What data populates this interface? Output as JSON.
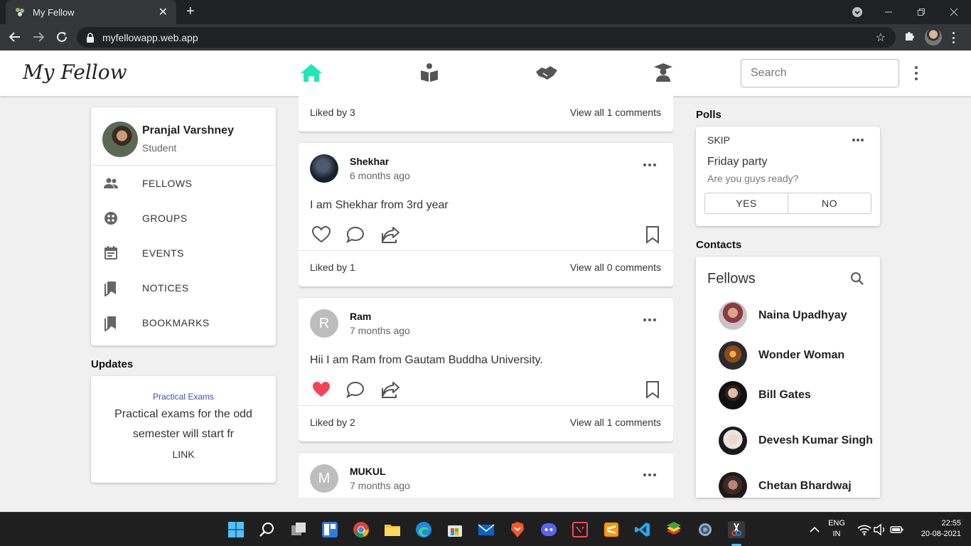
{
  "browser": {
    "tab_title": "My Fellow",
    "tab_close": "✕",
    "new_tab": "+",
    "url": "myfellowapp.web.app"
  },
  "app": {
    "logo": "My Fellow",
    "search_placeholder": "Search",
    "accent_color": "#1de9b6"
  },
  "profile": {
    "name": "Pranjal Varshney",
    "role": "Student"
  },
  "menu": [
    {
      "label": "FELLOWS",
      "icon": "people-icon"
    },
    {
      "label": "GROUPS",
      "icon": "groups-icon"
    },
    {
      "label": "EVENTS",
      "icon": "events-icon"
    },
    {
      "label": "NOTICES",
      "icon": "notices-icon"
    },
    {
      "label": "BOOKMARKS",
      "icon": "bookmarks-icon"
    }
  ],
  "updates": {
    "title": "Updates",
    "category": "Practical Exams",
    "text": "Practical exams for the odd semester will start fr",
    "link": "LINK"
  },
  "posts": [
    {
      "likes": "Liked by 3",
      "comments": "View all 1 comments"
    },
    {
      "name": "Shekhar",
      "time": "6 months ago",
      "text": "I am Shekhar from 3rd year",
      "liked": false,
      "likes": "Liked by 1",
      "comments": "View all 0 comments"
    },
    {
      "name": "Ram",
      "initial": "R",
      "time": "7 months ago",
      "text": "Hii I am Ram from Gautam Buddha University.",
      "liked": true,
      "likes": "Liked by 2",
      "comments": "View all 1 comments"
    },
    {
      "name": "MUKUL",
      "initial": "M",
      "time": "7 months ago"
    }
  ],
  "polls": {
    "title": "Polls",
    "skip": "SKIP",
    "question": "Friday party",
    "subtitle": "Are you guys ready?",
    "yes": "YES",
    "no": "NO"
  },
  "contacts": {
    "title": "Contacts",
    "panel_title": "Fellows",
    "list": [
      {
        "name": "Naina Upadhyay"
      },
      {
        "name": "Wonder Woman"
      },
      {
        "name": "Bill Gates"
      },
      {
        "name": "Devesh Kumar Singh"
      },
      {
        "name": "Chetan Bhardwaj"
      }
    ]
  },
  "taskbar": {
    "lang_line1": "ENG",
    "lang_line2": "IN",
    "time": "22:55",
    "date": "20-08-2021"
  }
}
